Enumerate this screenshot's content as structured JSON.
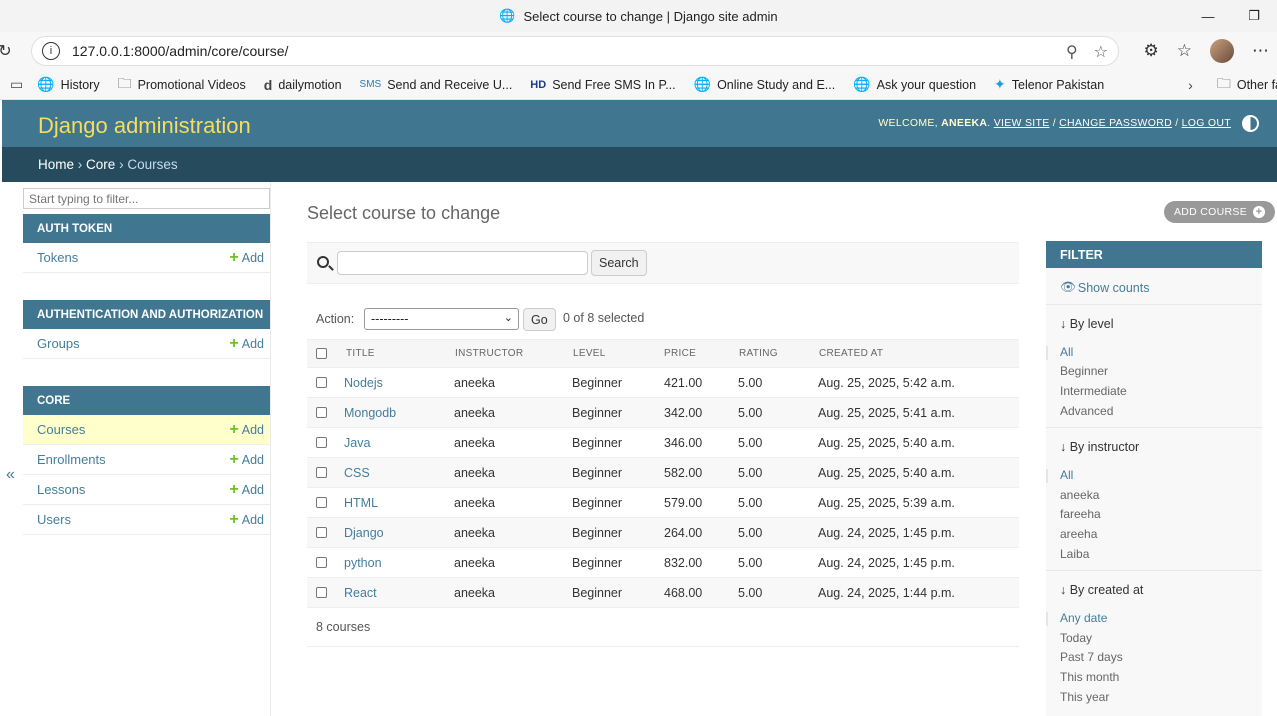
{
  "browser": {
    "tab_title": "Select course to change | Django site admin",
    "url": "127.0.0.1:8000/admin/core/course/",
    "bookmarks": [
      "History",
      "Promotional Videos",
      "dailymotion",
      "Send and Receive U...",
      "Send Free SMS In P...",
      "Online Study and E...",
      "Ask your question",
      "Telenor Pakistan"
    ],
    "other_favorites": "Other favo"
  },
  "header": {
    "brand": "Django administration",
    "welcome": "WELCOME,",
    "username": "ANEEKA",
    "view_site": "VIEW SITE",
    "change_password": "CHANGE PASSWORD",
    "log_out": "LOG OUT"
  },
  "breadcrumbs": {
    "home": "Home",
    "core": "Core",
    "current": "Courses",
    "sep": "›"
  },
  "sidebar": {
    "filter_placeholder": "Start typing to filter...",
    "add_label": "Add",
    "apps": [
      {
        "caption": "Auth Token",
        "models": [
          "Tokens"
        ]
      },
      {
        "caption": "Authentication and Authorization",
        "models": [
          "Groups"
        ]
      },
      {
        "caption": "Core",
        "models": [
          "Courses",
          "Enrollments",
          "Lessons",
          "Users"
        ]
      }
    ]
  },
  "main": {
    "title": "Select course to change",
    "add_button": "ADD COURSE",
    "search_button": "Search",
    "action_label": "Action:",
    "action_default": "---------",
    "go_button": "Go",
    "selected_count": "0 of 8 selected",
    "columns": [
      "TITLE",
      "INSTRUCTOR",
      "LEVEL",
      "PRICE",
      "RATING",
      "CREATED AT"
    ],
    "rows": [
      [
        "Nodejs",
        "aneeka",
        "Beginner",
        "421.00",
        "5.00",
        "Aug. 25, 2025, 5:42 a.m."
      ],
      [
        "Mongodb",
        "aneeka",
        "Beginner",
        "342.00",
        "5.00",
        "Aug. 25, 2025, 5:41 a.m."
      ],
      [
        "Java",
        "aneeka",
        "Beginner",
        "346.00",
        "5.00",
        "Aug. 25, 2025, 5:40 a.m."
      ],
      [
        "CSS",
        "aneeka",
        "Beginner",
        "582.00",
        "5.00",
        "Aug. 25, 2025, 5:40 a.m."
      ],
      [
        "HTML",
        "aneeka",
        "Beginner",
        "579.00",
        "5.00",
        "Aug. 25, 2025, 5:39 a.m."
      ],
      [
        "Django",
        "aneeka",
        "Beginner",
        "264.00",
        "5.00",
        "Aug. 24, 2025, 1:45 p.m."
      ],
      [
        "python",
        "aneeka",
        "Beginner",
        "832.00",
        "5.00",
        "Aug. 24, 2025, 1:45 p.m."
      ],
      [
        "React",
        "aneeka",
        "Beginner",
        "468.00",
        "5.00",
        "Aug. 24, 2025, 1:44 p.m."
      ]
    ],
    "result_count": "8 courses"
  },
  "filter": {
    "heading": "FILTER",
    "show_counts": "Show counts",
    "sections": [
      {
        "title": "↓ By level",
        "items": [
          "All",
          "Beginner",
          "Intermediate",
          "Advanced"
        ]
      },
      {
        "title": "↓ By instructor",
        "items": [
          "All",
          "aneeka",
          "fareeha",
          "areeha",
          "Laiba"
        ]
      },
      {
        "title": "↓ By created at",
        "items": [
          "Any date",
          "Today",
          "Past 7 days",
          "This month",
          "This year"
        ]
      }
    ]
  },
  "colors": {
    "header": "#417690",
    "breadcrumb": "#264b5d",
    "brand": "#f5dd5d",
    "link": "#447e9b",
    "add_plus": "#70bf2b",
    "current_row": "#ffffcc"
  }
}
